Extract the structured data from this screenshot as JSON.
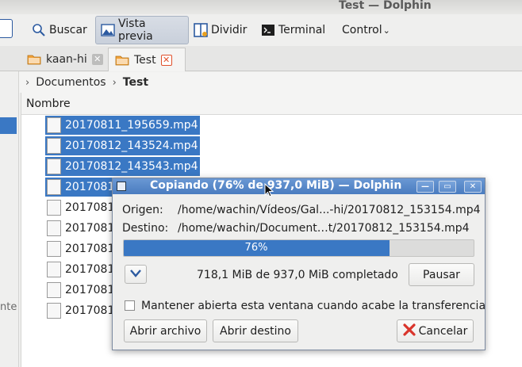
{
  "window": {
    "title": "Test — Dolphin"
  },
  "toolbar": {
    "search_label": "Buscar",
    "preview_label": "Vista previa",
    "split_label": "Dividir",
    "terminal_label": "Terminal",
    "control_label": "Control"
  },
  "tabs": [
    {
      "label": "kaan-hi",
      "active": false
    },
    {
      "label": "Test",
      "active": true
    }
  ],
  "breadcrumb": {
    "parent": "Documentos",
    "current": "Test"
  },
  "sidebar": {
    "fragment": "nte"
  },
  "file_list": {
    "column_name": "Nombre",
    "files": [
      {
        "name": "20170811_195659.mp4",
        "selected": true
      },
      {
        "name": "20170812_143524.mp4",
        "selected": true
      },
      {
        "name": "20170812_143543.mp4",
        "selected": true
      },
      {
        "name": "2017081",
        "selected": true
      },
      {
        "name": "2017081",
        "selected": false
      },
      {
        "name": "2017081",
        "selected": false
      },
      {
        "name": "2017081",
        "selected": false
      },
      {
        "name": "2017081",
        "selected": false
      },
      {
        "name": "2017081",
        "selected": false
      },
      {
        "name": "2017081",
        "selected": false
      }
    ]
  },
  "copy_dialog": {
    "title": "Copiando (76% de 937,0 MiB) — Dolphin",
    "origin_label": "Origen:",
    "origin_value": "/home/wachin/Vídeos/Gal...-hi/20170812_153154.mp4",
    "dest_label": "Destino:",
    "dest_value": "/home/wachin/Document…t/20170812_153154.mp4",
    "progress_text": "76%",
    "progress_fraction": 0.76,
    "completed_text": "718,1 MiB de 937,0 MiB completado",
    "pause_label": "Pausar",
    "keep_open_label": "Mantener abierta esta ventana cuando acabe la transferencia",
    "open_file_label": "Abrir archivo",
    "open_dest_label": "Abrir destino",
    "cancel_label": "Cancelar"
  },
  "colors": {
    "selection": "#3a78c4",
    "cancel_icon": "#d9342b"
  }
}
